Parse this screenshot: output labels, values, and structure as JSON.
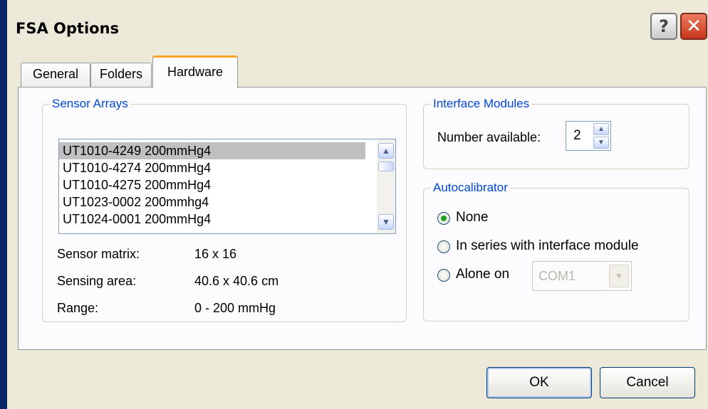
{
  "window": {
    "title": "FSA Options",
    "help_glyph": "?",
    "close_glyph": "✕"
  },
  "tabs": [
    {
      "label": "General"
    },
    {
      "label": "Folders"
    },
    {
      "label": "Hardware"
    }
  ],
  "sensor_arrays": {
    "legend": "Sensor Arrays",
    "items": [
      "UT1010-4249 200mmHg4",
      "UT1010-4274 200mmHg4",
      "UT1010-4275 200mmHg4",
      "UT1023-0002 200mmhg4",
      "UT1024-0001 200mmHg4"
    ],
    "selected_index": 0,
    "properties": [
      {
        "label": "Sensor matrix:",
        "value": "16 x 16"
      },
      {
        "label": "Sensing area:",
        "value": "40.6 x 40.6 cm"
      },
      {
        "label": "Range:",
        "value": "0 - 200 mmHg"
      }
    ]
  },
  "interface_modules": {
    "legend": "Interface Modules",
    "label": "Number available:",
    "value": "2"
  },
  "autocalibrator": {
    "legend": "Autocalibrator",
    "options": [
      "None",
      "In series with interface module",
      "Alone on"
    ],
    "selected": "None",
    "port_value": "COM1"
  },
  "buttons": {
    "ok": "OK",
    "cancel": "Cancel"
  }
}
